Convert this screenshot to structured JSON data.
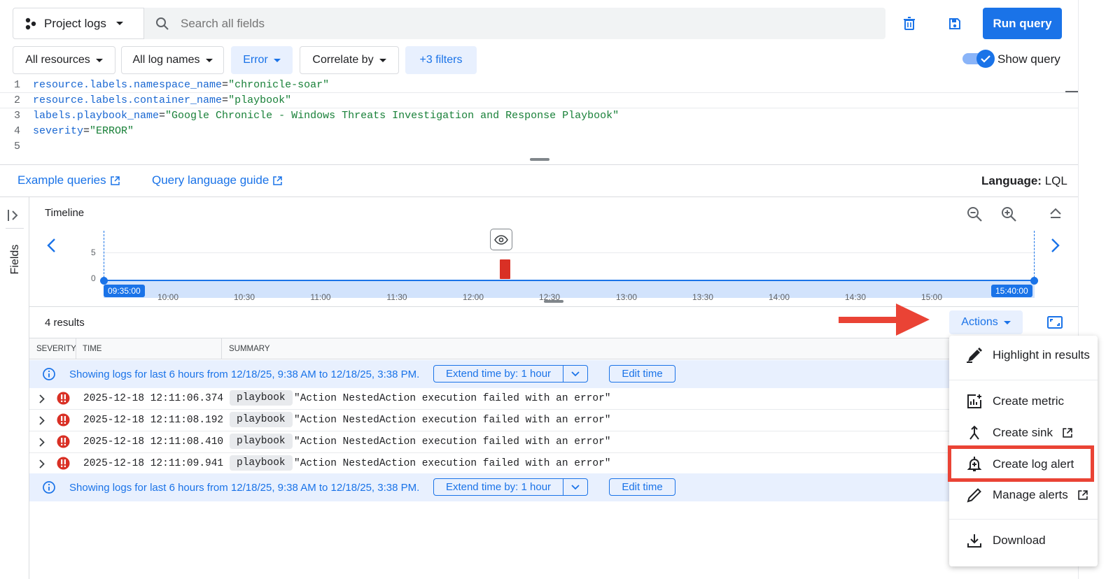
{
  "header": {
    "scope_label": "Project logs",
    "search_placeholder": "Search all fields",
    "run_query_label": "Run query"
  },
  "filters": {
    "resources": "All resources",
    "log_names": "All log names",
    "severity": "Error",
    "correlate": "Correlate by",
    "more_filters": "+3 filters",
    "show_query_label": "Show query"
  },
  "query": {
    "lines": [
      {
        "num": "1",
        "key": "resource.labels.namespace_name",
        "op": "=",
        "value": "\"chronicle-soar\""
      },
      {
        "num": "2",
        "key": "resource.labels.container_name",
        "op": "=",
        "value": "\"playbook\""
      },
      {
        "num": "3",
        "key": "labels.playbook_name",
        "op": "=",
        "value": "\"Google Chronicle - Windows Threats Investigation and Response Playbook\""
      },
      {
        "num": "4",
        "key": "severity",
        "op": "=",
        "value": "\"ERROR\""
      },
      {
        "num": "5",
        "key": "",
        "op": "",
        "value": ""
      }
    ]
  },
  "links": {
    "example_queries": "Example queries",
    "query_guide": "Query language guide",
    "language_label": "Language:",
    "language_value": "LQL"
  },
  "sidebar": {
    "fields_label": "Fields"
  },
  "timeline": {
    "title": "Timeline",
    "y_ticks": [
      "5",
      "0"
    ],
    "start_label": "09:35:00",
    "end_label": "15:40:00",
    "x_ticks": [
      "10:00",
      "10:30",
      "11:00",
      "11:30",
      "12:00",
      "12:30",
      "13:00",
      "13:30",
      "14:00",
      "14:30",
      "15:00"
    ],
    "bar_color": "#d93025"
  },
  "results": {
    "count_label": "4 results",
    "actions_label": "Actions",
    "columns": [
      "SEVERITY",
      "TIME",
      "SUMMARY"
    ],
    "info_text": "Showing logs for last 6 hours from 12/18/25, 9:38 AM to 12/18/25, 3:38 PM.",
    "extend_label": "Extend time by: 1 hour",
    "edit_time_label": "Edit time",
    "rows": [
      {
        "time": "2025-12-18 12:11:06.374",
        "tag": "playbook",
        "summary": "\"Action NestedAction execution failed with an error\""
      },
      {
        "time": "2025-12-18 12:11:08.192",
        "tag": "playbook",
        "summary": "\"Action NestedAction execution failed with an error\""
      },
      {
        "time": "2025-12-18 12:11:08.410",
        "tag": "playbook",
        "summary": "\"Action NestedAction execution failed with an error\""
      },
      {
        "time": "2025-12-18 12:11:09.941",
        "tag": "playbook",
        "summary": "\"Action NestedAction execution failed with an error\""
      }
    ]
  },
  "actions_menu": {
    "items": [
      "Highlight in results",
      "Create metric",
      "Create sink",
      "Create log alert",
      "Manage alerts",
      "Download"
    ],
    "highlight_color": "#ea4335"
  },
  "colors": {
    "accent": "#1a73e8",
    "error": "#d93025",
    "annotation": "#ea4335"
  }
}
